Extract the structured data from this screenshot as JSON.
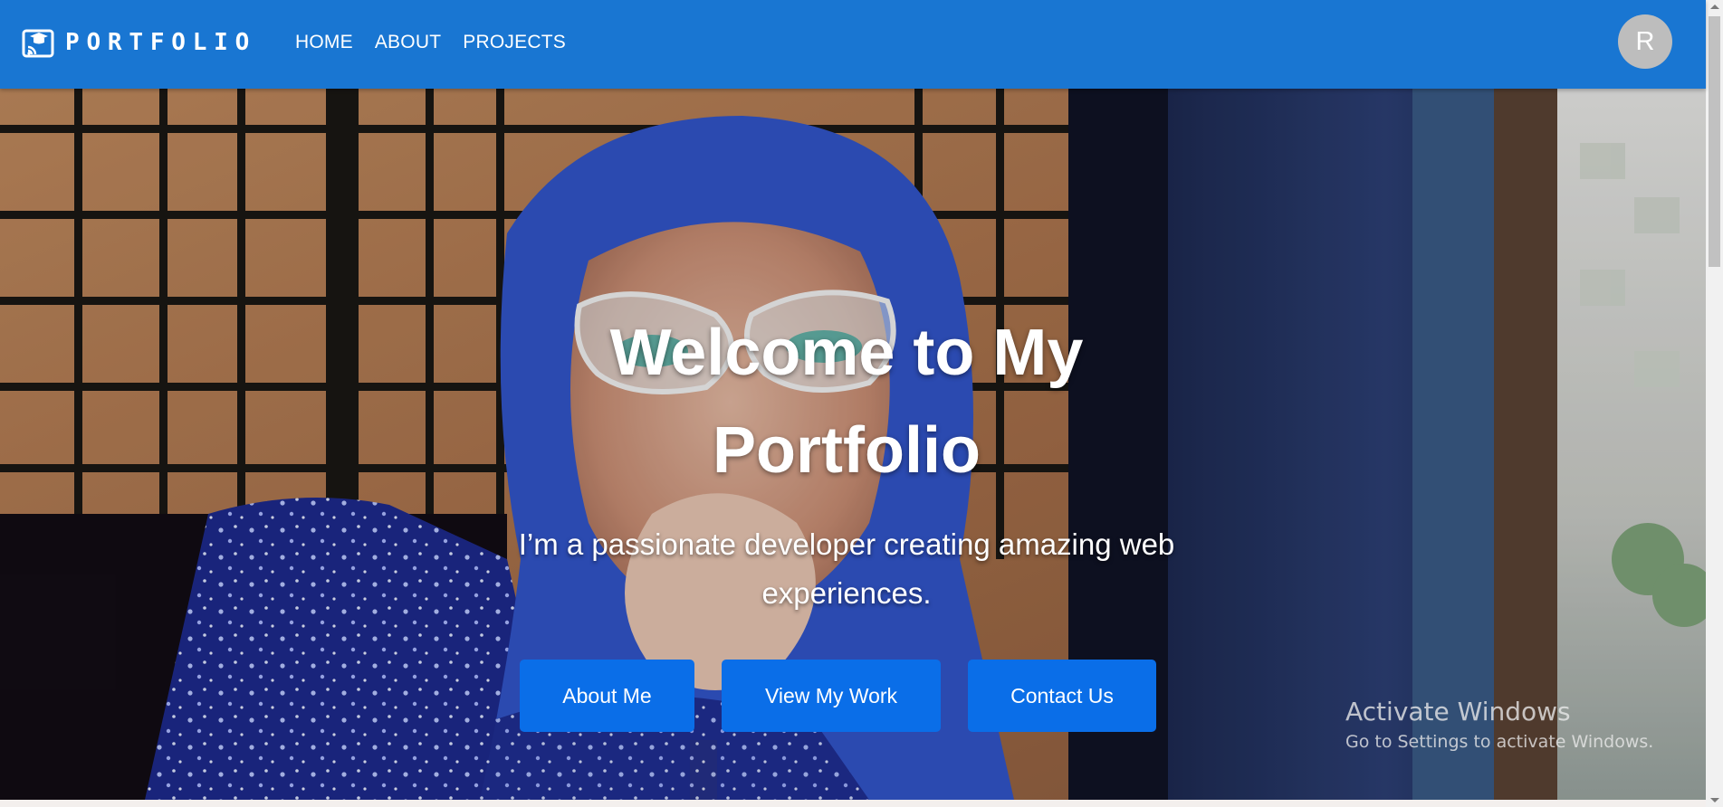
{
  "appbar": {
    "brand_icon": "web-book-icon",
    "brand": "PORTFOLIO",
    "nav": [
      {
        "label": "HOME"
      },
      {
        "label": "ABOUT"
      },
      {
        "label": "PROJECTS"
      }
    ],
    "avatar_letter": "R",
    "color": "#1976d2"
  },
  "hero": {
    "title": "Welcome to My Portfolio",
    "subtitle": "I’m a passionate developer creating amazing web experiences.",
    "background": "portrait photo of a woman in a blue hijab and glasses in front of a window grid",
    "buttons": [
      {
        "label": "About Me"
      },
      {
        "label": "View My Work"
      },
      {
        "label": "Contact Us"
      }
    ],
    "button_color": "#0a6ee8"
  },
  "watermark": {
    "title": "Activate Windows",
    "subtitle": "Go to Settings to activate Windows."
  }
}
